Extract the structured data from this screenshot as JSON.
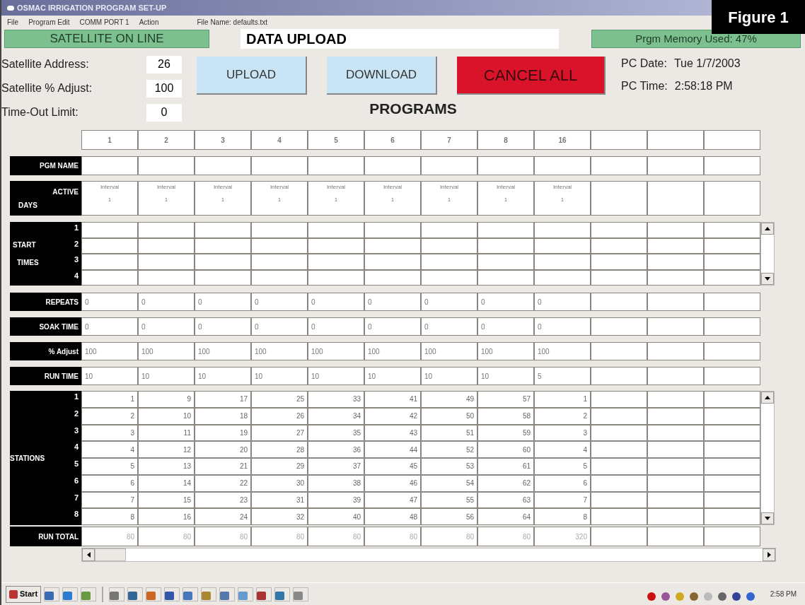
{
  "window": {
    "title": "OSMAC IRRIGATION PROGRAM SET-UP"
  },
  "figure_label": "Figure 1",
  "menu": [
    "File",
    "Program Edit",
    "COMM PORT 1",
    "Action"
  ],
  "file_name": "File Name: defaults.txt",
  "satellite_status": "SATELLITE ON LINE",
  "mode_title": "DATA UPLOAD",
  "memory": "Prgm Memory Used: 47%",
  "fields": [
    {
      "label": "Satellite Address:",
      "value": "26"
    },
    {
      "label": "Satellite % Adjust:",
      "value": "100"
    },
    {
      "label": "Time-Out Limit:",
      "value": "0"
    }
  ],
  "buttons": [
    {
      "label": "UPLOAD",
      "kind": "normal"
    },
    {
      "label": "DOWNLOAD",
      "kind": "normal"
    },
    {
      "label": "CANCEL ALL",
      "kind": "danger"
    }
  ],
  "pc_date": {
    "label": "PC Date:",
    "value": "Tue 1/7/2003"
  },
  "pc_time": {
    "label": "PC Time:",
    "value": "2:58:18 PM"
  },
  "programs_title": "PROGRAMS",
  "row_labels": {
    "pgm_name": "PGM NAME",
    "active_days": [
      "ACTIVE",
      "DAYS"
    ],
    "start_times": [
      "START",
      "TIMES"
    ],
    "start_numbers": [
      "1",
      "2",
      "3",
      "4"
    ],
    "repeats": "REPEATS",
    "soak_time": "SOAK TIME",
    "adjust": "% Adjust",
    "run_time": "RUN TIME",
    "stations": "STATIONS",
    "station_numbers": [
      "1",
      "2",
      "3",
      "4",
      "5",
      "6",
      "7",
      "8"
    ],
    "run_total": "RUN TOTAL"
  },
  "programs": [
    {
      "kind": "program",
      "number": "1",
      "active_days": "Interval",
      "interval": "1",
      "repeats": "0",
      "soak_time": "0",
      "adjust": "100",
      "run_time": "10",
      "stations": [
        "1",
        "2",
        "3",
        "4",
        "5",
        "6",
        "7",
        "8"
      ],
      "run_total": "80"
    },
    {
      "kind": "program",
      "number": "2",
      "active_days": "Interval",
      "interval": "1",
      "repeats": "0",
      "soak_time": "0",
      "adjust": "100",
      "run_time": "10",
      "stations": [
        "9",
        "10",
        "11",
        "12",
        "13",
        "14",
        "15",
        "16"
      ],
      "run_total": "80"
    },
    {
      "kind": "program",
      "number": "3",
      "active_days": "Interval",
      "interval": "1",
      "repeats": "0",
      "soak_time": "0",
      "adjust": "100",
      "run_time": "10",
      "stations": [
        "17",
        "18",
        "19",
        "20",
        "21",
        "22",
        "23",
        "24"
      ],
      "run_total": "80"
    },
    {
      "kind": "program",
      "number": "4",
      "active_days": "Interval",
      "interval": "1",
      "repeats": "0",
      "soak_time": "0",
      "adjust": "100",
      "run_time": "10",
      "stations": [
        "25",
        "26",
        "27",
        "28",
        "29",
        "30",
        "31",
        "32"
      ],
      "run_total": "80"
    },
    {
      "kind": "program",
      "number": "5",
      "active_days": "Interval",
      "interval": "1",
      "repeats": "0",
      "soak_time": "0",
      "adjust": "100",
      "run_time": "10",
      "stations": [
        "33",
        "34",
        "35",
        "36",
        "37",
        "38",
        "39",
        "40"
      ],
      "run_total": "80"
    },
    {
      "kind": "program",
      "number": "6",
      "active_days": "Interval",
      "interval": "1",
      "repeats": "0",
      "soak_time": "0",
      "adjust": "100",
      "run_time": "10",
      "stations": [
        "41",
        "42",
        "43",
        "44",
        "45",
        "46",
        "47",
        "48"
      ],
      "run_total": "80"
    },
    {
      "kind": "program",
      "number": "7",
      "active_days": "Interval",
      "interval": "1",
      "repeats": "0",
      "soak_time": "0",
      "adjust": "100",
      "run_time": "10",
      "stations": [
        "49",
        "50",
        "51",
        "52",
        "53",
        "54",
        "55",
        "56"
      ],
      "run_total": "80"
    },
    {
      "kind": "program",
      "number": "8",
      "active_days": "Interval",
      "interval": "1",
      "repeats": "0",
      "soak_time": "0",
      "adjust": "100",
      "run_time": "10",
      "stations": [
        "57",
        "58",
        "59",
        "60",
        "61",
        "62",
        "63",
        "64"
      ],
      "run_total": "80"
    },
    {
      "kind": "program",
      "number": "16",
      "active_days": "Interval",
      "interval": "1",
      "repeats": "0",
      "soak_time": "0",
      "adjust": "100",
      "run_time": "5",
      "stations": [
        "1",
        "2",
        "3",
        "4",
        "5",
        "6",
        "7",
        "8"
      ],
      "run_total": "320"
    },
    {
      "kind": "blank"
    },
    {
      "kind": "blank"
    },
    {
      "kind": "blank"
    }
  ],
  "taskbar": {
    "start": "Start",
    "clock": "2:58 PM"
  }
}
